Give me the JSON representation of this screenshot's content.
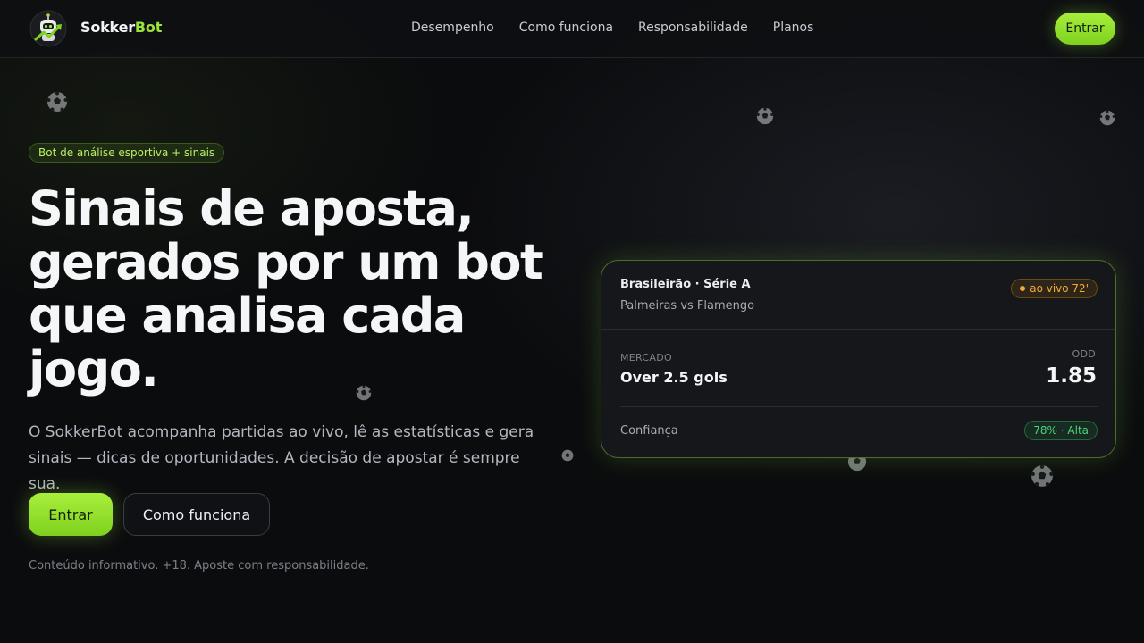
{
  "nav": {
    "brand_prefix": "Sokker",
    "brand_accent": "Bot",
    "links": [
      "Desempenho",
      "Como funciona",
      "Responsabilidade",
      "Planos"
    ],
    "enter_label": "Entrar"
  },
  "hero": {
    "badge": "Bot de análise esportiva + sinais",
    "headline": "Sinais de aposta, gerados por um bot que analisa cada jogo.",
    "subtext": "O SokkerBot acompanha partidas ao vivo, lê as estatísticas e gera sinais — dicas de oportunidades. A decisão de apostar é sempre sua.",
    "primary_button": "Entrar",
    "secondary_button": "Como funciona",
    "disclaimer": "Conteúdo informativo. +18. Aposte com responsabilidade."
  },
  "card": {
    "league": "Brasileirão · Série A",
    "match": "Palmeiras vs Flamengo",
    "live_badge": "ao vivo 72'",
    "market_label": "MERCADO",
    "market_value": "Over 2.5 gols",
    "odd_label": "ODD",
    "odd_value": "1.85",
    "confidence_label": "Confiança",
    "confidence_value": "78% · Alta"
  },
  "colors": {
    "accent": "#9be33a",
    "background": "#0b0c0e",
    "live": "#f2a93b",
    "confidence": "#4bd47a"
  },
  "icons": [
    "robot-logo-icon",
    "soccer-ball-icon"
  ]
}
